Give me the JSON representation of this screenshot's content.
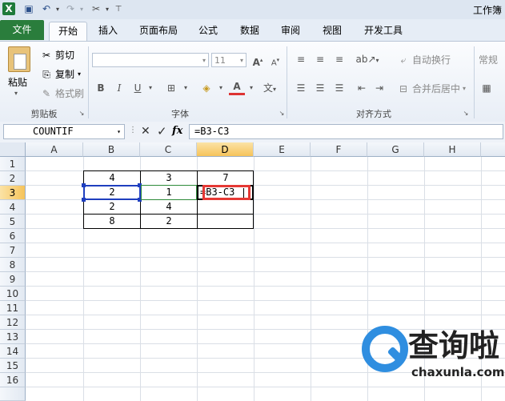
{
  "titlebar": {
    "title": "工作簿",
    "excel_icon": "excel-logo-icon"
  },
  "tabs": [
    "文件",
    "开始",
    "插入",
    "页面布局",
    "公式",
    "数据",
    "审阅",
    "视图",
    "开发工具"
  ],
  "ribbon": {
    "clipboard": {
      "paste": "粘贴",
      "cut": "剪切",
      "copy": "复制",
      "format_painter": "格式刷",
      "label": "剪贴板"
    },
    "font": {
      "size": "11",
      "label": "字体",
      "bold": "B",
      "italic": "I",
      "underline": "U",
      "grow": "A",
      "shrink": "A",
      "wen": "wén"
    },
    "alignment": {
      "wrap": "自动换行",
      "merge": "合并后居中",
      "label": "对齐方式"
    },
    "number": {
      "format": "常规"
    }
  },
  "formula_bar": {
    "name_box": "COUNTIF",
    "cancel": "✕",
    "enter": "✓",
    "fx": "fx",
    "formula": "=B3-C3"
  },
  "sheet": {
    "columns": [
      "A",
      "B",
      "C",
      "D",
      "E",
      "F",
      "G",
      "H"
    ],
    "rows": [
      "1",
      "2",
      "3",
      "4",
      "5",
      "6",
      "7",
      "8",
      "9",
      "10",
      "11",
      "12",
      "13",
      "14",
      "15",
      "16"
    ],
    "cells": {
      "B2": "4",
      "C2": "3",
      "D2": "7",
      "B3": "2",
      "C3": "1",
      "D3": "=B3-C3",
      "B4": "2",
      "C4": "4",
      "B5": "8",
      "C5": "2"
    }
  },
  "watermark": {
    "brand": "查询啦",
    "url": "chaxunla.com"
  },
  "colors": {
    "file_tab": "#2a7d3c",
    "header_selected": "#f6c35a",
    "edit_highlight": "#e53935",
    "ref_blue": "#1f3fbf",
    "ref_green": "#2e8b3a",
    "watermark_blue": "#2f8ee0"
  }
}
